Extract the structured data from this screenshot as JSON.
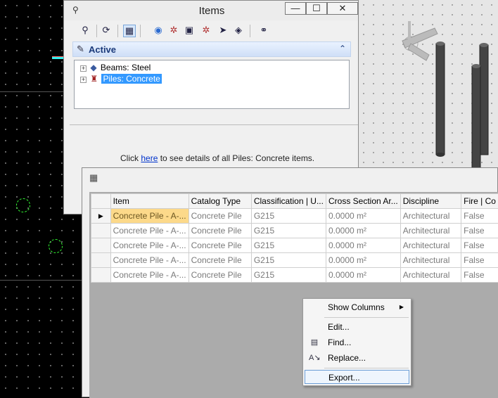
{
  "items_window": {
    "title": "Items",
    "controls": {
      "minimize": "—",
      "maximize": "☐",
      "close": "✕"
    },
    "active_section": {
      "label": "Active",
      "tree": [
        {
          "label": "Beams: Steel",
          "expander": "+"
        },
        {
          "label": "Piles: Concrete",
          "expander": "+",
          "selected": true
        }
      ]
    },
    "details": {
      "prefix": "Click ",
      "link": "here",
      "suffix": " to see details of all Piles: Concrete items."
    }
  },
  "grid": {
    "columns": [
      "Item",
      "Catalog Type",
      "Classification | U...",
      "Cross Section Ar...",
      "Discipline",
      "Fire | Co"
    ],
    "rows": [
      [
        "Concrete Pile - A-...",
        "Concrete Pile",
        "G215",
        "0.0000 m²",
        "Architectural",
        "False"
      ],
      [
        "Concrete Pile - A-...",
        "Concrete Pile",
        "G215",
        "0.0000 m²",
        "Architectural",
        "False"
      ],
      [
        "Concrete Pile - A-...",
        "Concrete Pile",
        "G215",
        "0.0000 m²",
        "Architectural",
        "False"
      ],
      [
        "Concrete Pile - A-...",
        "Concrete Pile",
        "G215",
        "0.0000 m²",
        "Architectural",
        "False"
      ],
      [
        "Concrete Pile - A-...",
        "Concrete Pile",
        "G215",
        "0.0000 m²",
        "Architectural",
        "False"
      ]
    ],
    "current_row_marker": "▶"
  },
  "context_menu": {
    "items": [
      {
        "label": "Show Columns",
        "submenu_arrow": "▶"
      },
      {
        "label": "Edit..."
      },
      {
        "label": "Find..."
      },
      {
        "label": "Replace..."
      },
      {
        "label": "Export..."
      }
    ]
  },
  "colors": {
    "selection_blue": "#3399ff",
    "selected_cell": "#fcd98a",
    "accent_header": "#cfdff7"
  }
}
